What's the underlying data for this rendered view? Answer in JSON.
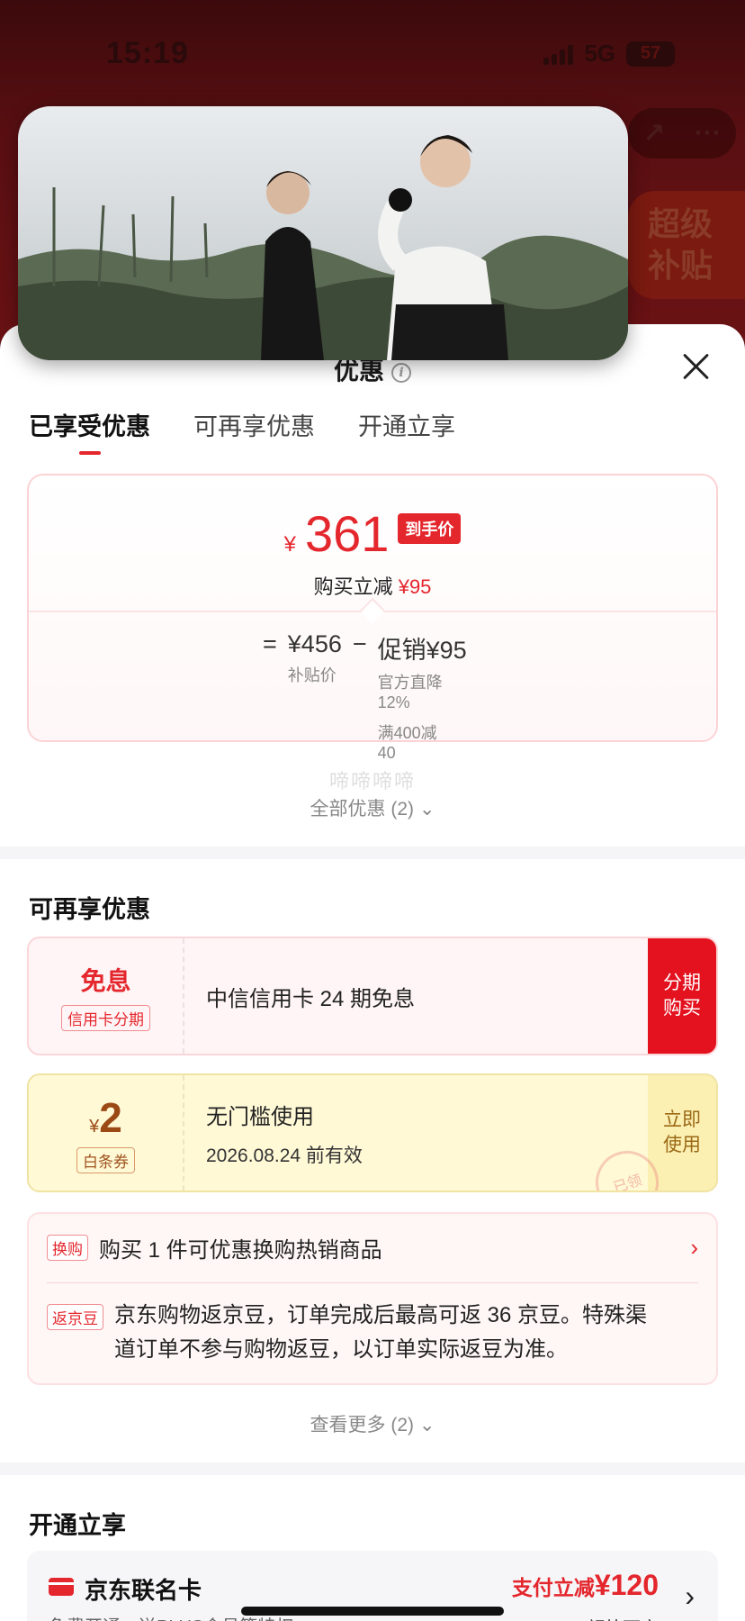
{
  "status_bar": {
    "time": "15:19",
    "network": "5G",
    "battery": "57"
  },
  "background": {
    "toolbar_icons": [
      "share-icon",
      "more-icon"
    ],
    "super_subsidy": [
      "超级",
      "补贴"
    ]
  },
  "sheet": {
    "title": "优惠",
    "tabs": [
      {
        "label": "已享受优惠",
        "active": true
      },
      {
        "label": "可再享优惠",
        "active": false
      },
      {
        "label": "开通立享",
        "active": false
      }
    ],
    "price_card": {
      "currency": "¥",
      "final_price": "361",
      "final_badge": "到手价",
      "buy_reduce_label": "购买立减",
      "buy_reduce_amount": "¥95",
      "equals": "=",
      "subsidy_price": "¥456",
      "subsidy_label": "补贴价",
      "minus": "−",
      "promo": "促销¥95",
      "promo_detail_1": "官方直降",
      "promo_detail_1b": "12%",
      "promo_detail_2": "满400减",
      "promo_detail_2b": "40"
    },
    "watermark": "啼啼啼啼",
    "all_offers": "全部优惠 (2)"
  },
  "reenjoy": {
    "title": "可再享优惠",
    "credit_coupon": {
      "big": "免息",
      "tag": "信用卡分期",
      "title": "中信信用卡 24 期免息",
      "action": [
        "分期",
        "购买"
      ]
    },
    "baitiao_coupon": {
      "currency": "¥",
      "amount": "2",
      "tag": "白条券",
      "title": "无门槛使用",
      "validity": "2026.08.24 前有效",
      "action": [
        "立即",
        "使用"
      ],
      "stamp": "已领"
    },
    "exchange": {
      "tag": "换购",
      "text": "购买 1 件可优惠换购热销商品"
    },
    "beans": {
      "tag": "返京豆",
      "text_line1": "京东购物返京豆，订单完成后最高可返 36 京豆。特殊渠",
      "text_line2": "道订单不参与购物返豆，以订单实际返豆为准。"
    },
    "see_more": "查看更多 (2)"
  },
  "open_enjoy": {
    "title": "开通立享",
    "jd_card": {
      "title": "京东联名卡",
      "subtitle": "免费开通，送PLUS会员等特权",
      "pay_label": "支付立减",
      "pay_amount": "¥120",
      "extra": "额外可享"
    }
  },
  "colors": {
    "accent": "#e4262d",
    "gold": "#9b4a16",
    "background_dim": "#5a1010"
  }
}
